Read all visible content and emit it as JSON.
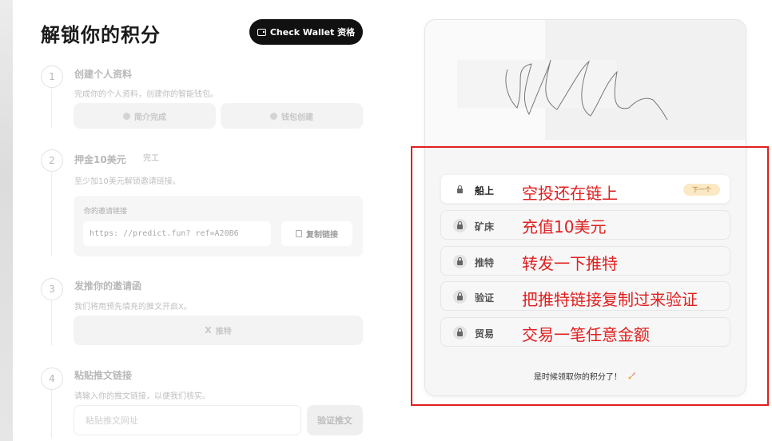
{
  "page": {
    "title": "解锁你的积分"
  },
  "wallet_button": {
    "label": "Check Wallet 资格"
  },
  "steps": [
    {
      "num": "1",
      "title": "创建个人资料",
      "desc": "完成你的个人资料，创建你的智能钱包。",
      "buttons": [
        "简介完成",
        "钱包创建"
      ]
    },
    {
      "num": "2",
      "title": "押金10美元",
      "tag": "完工",
      "desc": "至少加10美元解锁邀请链接。",
      "invite_label": "你的邀请链接",
      "invite_url": "https: //predict.fun? ref=A20B6",
      "copy_label": "复制链接"
    },
    {
      "num": "3",
      "title": "发推你的邀请函",
      "desc": "我们将用预先填充的推文开启X。",
      "button_icon": "X",
      "button_label": "推特"
    },
    {
      "num": "4",
      "title": "粘贴推文链接",
      "desc": "请输入你的推文链接，以便我们核实。",
      "input_placeholder": "粘贴推文网址",
      "verify_label": "验证推文"
    }
  ],
  "card": {
    "rows": [
      {
        "label": "船上",
        "badge": "下一个"
      },
      {
        "label": "矿床"
      },
      {
        "label": "推特"
      },
      {
        "label": "验证"
      },
      {
        "label": "贸易"
      }
    ],
    "footer": "是时候领取你的积分了！",
    "footer_icon": "rocket-icon"
  },
  "annotations": [
    "空投还在链上",
    "充值10美元",
    "转发一下推特",
    "把推特链接复制过来验证",
    "交易一笔任意金额"
  ],
  "colors": {
    "annotation": "#e02020",
    "badge_bg": "#fbe9c6",
    "button_dark": "#111111"
  }
}
